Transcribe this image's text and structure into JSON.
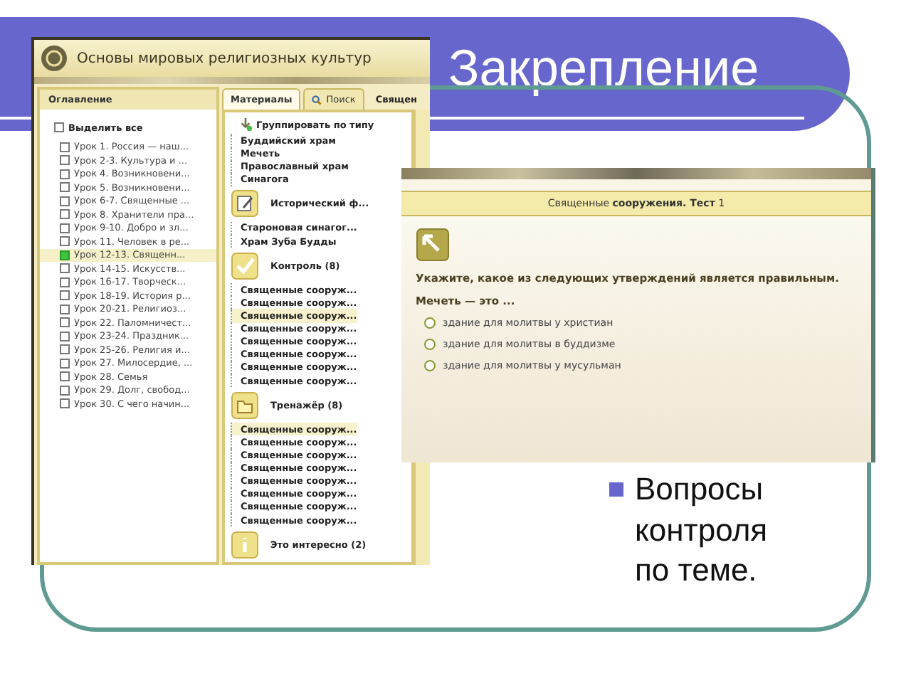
{
  "slide": {
    "title": "Закрепление",
    "bullets": [
      "Вопросы контроля по теме."
    ]
  },
  "app_window": {
    "title": "Основы мировых религиозных культур",
    "toc": {
      "header": "Оглавление",
      "select_all": {
        "label": "Выделить все",
        "checked": false
      },
      "items": [
        {
          "label": "Урок 1. Россия — наш...",
          "checked": false,
          "selected": false
        },
        {
          "label": "Урок 2-3. Культура и ...",
          "checked": false,
          "selected": false
        },
        {
          "label": "Урок 4. Возникновени...",
          "checked": false,
          "selected": false
        },
        {
          "label": "Урок 5. Возникновени...",
          "checked": false,
          "selected": false
        },
        {
          "label": "Урок 6-7. Священные ...",
          "checked": false,
          "selected": false
        },
        {
          "label": "Урок 8. Хранители пра...",
          "checked": false,
          "selected": false
        },
        {
          "label": "Урок 9-10. Добро и зл...",
          "checked": false,
          "selected": false
        },
        {
          "label": "Урок 11. Человек в ре...",
          "checked": false,
          "selected": false
        },
        {
          "label": "Урок 12-13. Священн...",
          "checked": true,
          "selected": true
        },
        {
          "label": "Урок 14-15. Искусств...",
          "checked": false,
          "selected": false
        },
        {
          "label": "Урок 16-17. Творческ...",
          "checked": false,
          "selected": false
        },
        {
          "label": "Урок 18-19. История р...",
          "checked": false,
          "selected": false
        },
        {
          "label": "Урок 20-21. Религиоз...",
          "checked": false,
          "selected": false
        },
        {
          "label": "Урок 22. Паломничест...",
          "checked": false,
          "selected": false
        },
        {
          "label": "Урок 23-24. Праздник...",
          "checked": false,
          "selected": false
        },
        {
          "label": "Урок 25-26. Религия и...",
          "checked": false,
          "selected": false
        },
        {
          "label": "Урок 27. Милосердие, ...",
          "checked": false,
          "selected": false
        },
        {
          "label": "Урок 28. Семья",
          "checked": false,
          "selected": false
        },
        {
          "label": "Урок 29. Долг, свобод...",
          "checked": false,
          "selected": false
        },
        {
          "label": "Урок 30. С чего начин...",
          "checked": false,
          "selected": false
        }
      ]
    },
    "materials": {
      "tabs": [
        {
          "label": "Материалы",
          "selected": true
        },
        {
          "label": "Поиск",
          "selected": false
        }
      ],
      "next_tab": "Священ",
      "group_by": "Группировать по типу",
      "groups": [
        {
          "kind": "plain",
          "items": [
            {
              "label": "Буддийский храм",
              "selected": false
            },
            {
              "label": "Мечеть",
              "selected": false
            },
            {
              "label": "Православный храм",
              "selected": false
            },
            {
              "label": "Синагога",
              "selected": false
            }
          ]
        },
        {
          "kind": "note",
          "title": "Исторический ф...",
          "items": [
            {
              "label": "Староновая синагог...",
              "selected": false
            },
            {
              "label": "Храм Зуба Будды",
              "selected": false
            }
          ]
        },
        {
          "kind": "check",
          "title": "Контроль (8)",
          "items": [
            {
              "label": "Священные сооруж...",
              "selected": false
            },
            {
              "label": "Священные сооруж...",
              "selected": false
            },
            {
              "label": "Священные сооруж...",
              "selected": true
            },
            {
              "label": "Священные сооруж...",
              "selected": false
            },
            {
              "label": "Священные сооруж...",
              "selected": false
            },
            {
              "label": "Священные сооруж...",
              "selected": false
            },
            {
              "label": "Священные сооруж...",
              "selected": false
            },
            {
              "label": "Священные сооруж...",
              "selected": false
            }
          ]
        },
        {
          "kind": "folder",
          "title": "Тренажёр (8)",
          "items": [
            {
              "label": "Священные сооруж...",
              "selected": true
            },
            {
              "label": "Священные сооруж...",
              "selected": false
            },
            {
              "label": "Священные сооруж...",
              "selected": false
            },
            {
              "label": "Священные сооруж...",
              "selected": false
            },
            {
              "label": "Священные сооруж...",
              "selected": false
            },
            {
              "label": "Священные сооруж...",
              "selected": false
            },
            {
              "label": "Священные сооруж...",
              "selected": false
            },
            {
              "label": "Священные сооруж...",
              "selected": false
            }
          ]
        },
        {
          "kind": "info",
          "title": "Это интересно (2)"
        }
      ]
    }
  },
  "test_window": {
    "title": "Священные **сооружения. Тест** 1",
    "question": "Укажите, какое из следующих утверждений является правильным.",
    "prompt": "Мечеть — это ...",
    "options": [
      {
        "label": "здание для молитвы у христиан",
        "selected": false
      },
      {
        "label": "здание для молитвы в буддизме",
        "selected": false
      },
      {
        "label": "здание для молитвы у мусульман",
        "selected": false
      }
    ]
  }
}
